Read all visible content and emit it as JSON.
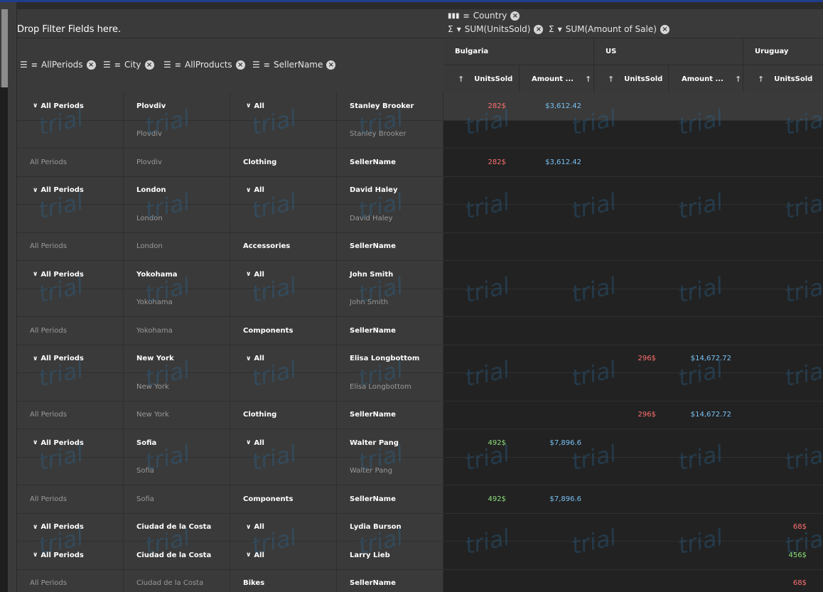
{
  "filter_zone": {
    "label": "Drop Filter Fields here."
  },
  "column_fields": {
    "label": "Country"
  },
  "value_fields": [
    {
      "label": "SUM(UnitsSold)"
    },
    {
      "label": "SUM(Amount of Sale)"
    }
  ],
  "row_fields": [
    {
      "label": "AllPeriods"
    },
    {
      "label": "City"
    },
    {
      "label": "AllProducts"
    },
    {
      "label": "SellerName"
    }
  ],
  "countries": [
    {
      "label": "Bulgaria"
    },
    {
      "label": "US"
    },
    {
      "label": "Uruguay"
    }
  ],
  "measure_headers": [
    {
      "label": "UnitsSold"
    },
    {
      "label": "Amount ..."
    },
    {
      "label": "UnitsSold"
    },
    {
      "label": "Amount ..."
    },
    {
      "label": "UnitsSold"
    }
  ],
  "watermark": "trial",
  "colors": {
    "red": "#ff7070",
    "blue": "#79c3f5",
    "green": "#8ee07a"
  },
  "rows": [
    {
      "kind": "expand",
      "period": "All Periods",
      "city": "Plovdiv",
      "product": "All",
      "seller": "Stanley Brooker",
      "bg_units": "282$",
      "bg_units_color": "red",
      "bg_amount": "$3,612.42",
      "us_units": "",
      "us_amount": "",
      "uy_units": "",
      "uy_units_color": ""
    },
    {
      "kind": "detail",
      "period": "",
      "city": "Plovdiv",
      "product": "",
      "seller": "Stanley Brooker",
      "bg_units": "",
      "bg_amount": "",
      "us_units": "",
      "us_amount": "",
      "uy_units": ""
    },
    {
      "kind": "total",
      "period": "All Periods",
      "city": "Plovdiv",
      "product": "Clothing",
      "seller": "SellerName",
      "bg_units": "282$",
      "bg_units_color": "red",
      "bg_amount": "$3,612.42",
      "us_units": "",
      "us_amount": "",
      "uy_units": ""
    },
    {
      "kind": "expand",
      "period": "All Periods",
      "city": "London",
      "product": "All",
      "seller": "David Haley",
      "bg_units": "",
      "bg_amount": "",
      "us_units": "",
      "us_amount": "",
      "uy_units": ""
    },
    {
      "kind": "detail",
      "period": "",
      "city": "London",
      "product": "",
      "seller": "David Haley",
      "bg_units": "",
      "bg_amount": "",
      "us_units": "",
      "us_amount": "",
      "uy_units": ""
    },
    {
      "kind": "total",
      "period": "All Periods",
      "city": "London",
      "product": "Accessories",
      "seller": "SellerName",
      "bg_units": "",
      "bg_amount": "",
      "us_units": "",
      "us_amount": "",
      "uy_units": ""
    },
    {
      "kind": "expand",
      "period": "All Periods",
      "city": "Yokohama",
      "product": "All",
      "seller": "John Smith",
      "bg_units": "",
      "bg_amount": "",
      "us_units": "",
      "us_amount": "",
      "uy_units": ""
    },
    {
      "kind": "detail",
      "period": "",
      "city": "Yokohama",
      "product": "",
      "seller": "John Smith",
      "bg_units": "",
      "bg_amount": "",
      "us_units": "",
      "us_amount": "",
      "uy_units": ""
    },
    {
      "kind": "total",
      "period": "All Periods",
      "city": "Yokohama",
      "product": "Components",
      "seller": "SellerName",
      "bg_units": "",
      "bg_amount": "",
      "us_units": "",
      "us_amount": "",
      "uy_units": ""
    },
    {
      "kind": "expand",
      "period": "All Periods",
      "city": "New York",
      "product": "All",
      "seller": "Elisa Longbottom",
      "bg_units": "",
      "bg_amount": "",
      "us_units": "296$",
      "us_units_color": "red",
      "us_amount": "$14,672.72",
      "uy_units": ""
    },
    {
      "kind": "detail",
      "period": "",
      "city": "New York",
      "product": "",
      "seller": "Elisa Longbottom",
      "bg_units": "",
      "bg_amount": "",
      "us_units": "",
      "us_amount": "",
      "uy_units": ""
    },
    {
      "kind": "total",
      "period": "All Periods",
      "city": "New York",
      "product": "Clothing",
      "seller": "SellerName",
      "bg_units": "",
      "bg_amount": "",
      "us_units": "296$",
      "us_units_color": "red",
      "us_amount": "$14,672.72",
      "uy_units": ""
    },
    {
      "kind": "expand",
      "period": "All Periods",
      "city": "Sofia",
      "product": "All",
      "seller": "Walter Pang",
      "bg_units": "492$",
      "bg_units_color": "green",
      "bg_amount": "$7,896.6",
      "us_units": "",
      "us_amount": "",
      "uy_units": ""
    },
    {
      "kind": "detail",
      "period": "",
      "city": "Sofia",
      "product": "",
      "seller": "Walter Pang",
      "bg_units": "",
      "bg_amount": "",
      "us_units": "",
      "us_amount": "",
      "uy_units": ""
    },
    {
      "kind": "total",
      "period": "All Periods",
      "city": "Sofia",
      "product": "Components",
      "seller": "SellerName",
      "bg_units": "492$",
      "bg_units_color": "green",
      "bg_amount": "$7,896.6",
      "us_units": "",
      "us_amount": "",
      "uy_units": ""
    },
    {
      "kind": "expand",
      "period": "All Periods",
      "city": "Ciudad de la Costa",
      "product": "All",
      "seller": "Lydia Burson",
      "bg_units": "",
      "bg_amount": "",
      "us_units": "",
      "us_amount": "",
      "uy_units": "68$",
      "uy_units_color": "red"
    },
    {
      "kind": "expand",
      "period": "All Periods",
      "city": "Ciudad de la Costa",
      "product": "All",
      "seller": "Larry Lieb",
      "bg_units": "",
      "bg_amount": "",
      "us_units": "",
      "us_amount": "",
      "uy_units": "456$",
      "uy_units_color": "green"
    },
    {
      "kind": "total",
      "period": "All Periods",
      "city": "Ciudad de la Costa",
      "product": "Bikes",
      "seller": "SellerName",
      "bg_units": "",
      "bg_amount": "",
      "us_units": "",
      "us_amount": "",
      "uy_units": "68$",
      "uy_units_color": "red"
    }
  ]
}
